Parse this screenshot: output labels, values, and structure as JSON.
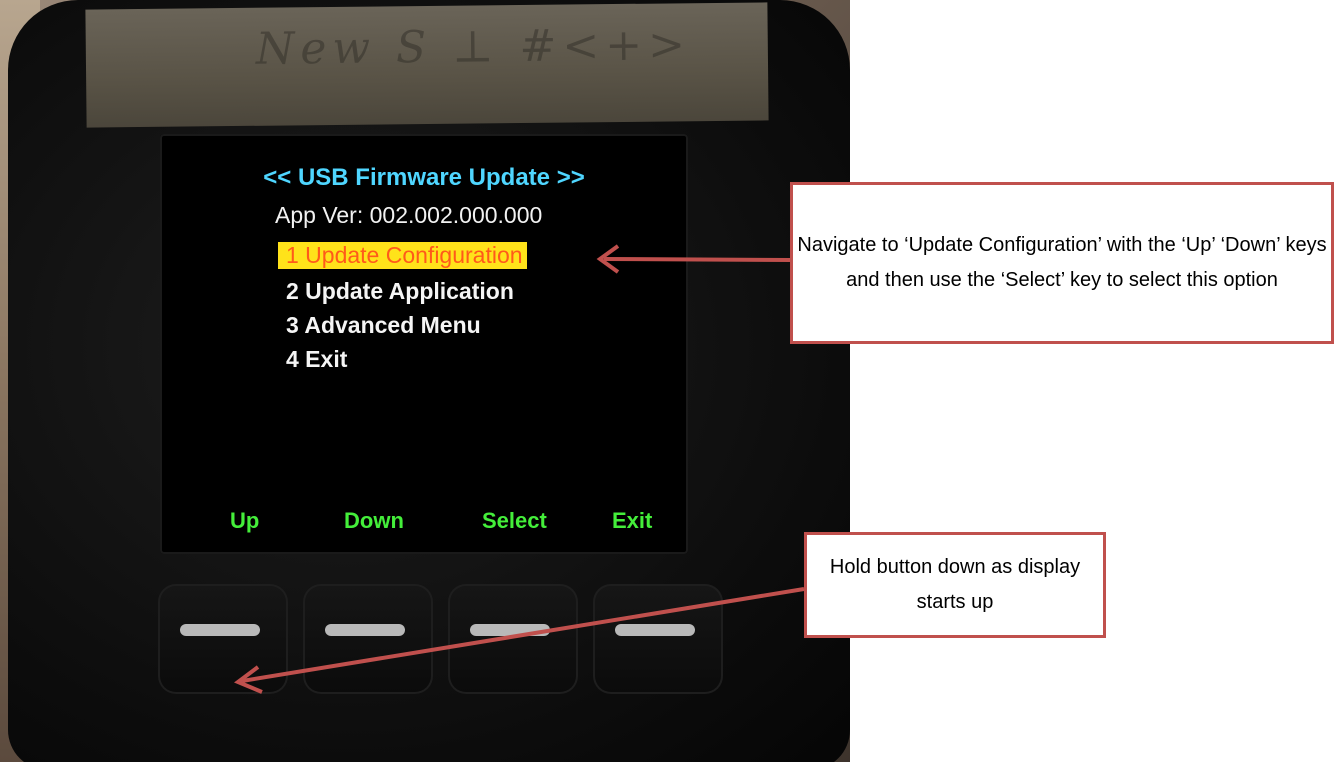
{
  "screen": {
    "title": "<< USB Firmware Update >>",
    "version": "App Ver: 002.002.000.000",
    "menu": [
      {
        "label": "1 Update Configuration",
        "selected": true
      },
      {
        "label": "2 Update Application",
        "selected": false
      },
      {
        "label": "3 Advanced Menu",
        "selected": false
      },
      {
        "label": "4 Exit",
        "selected": false
      }
    ],
    "softkeys": [
      "Up",
      "Down",
      "Select",
      "Exit"
    ]
  },
  "callouts": {
    "navigate": "Navigate to ‘Update Configuration’ with the ‘Up’ ‘Down’ keys and then use the ‘Select’ key to select this option",
    "hold": "Hold button down as display starts up"
  },
  "colors": {
    "screen_title": "#4fd6ff",
    "selected_bg": "#ffe21a",
    "selected_text": "#ff5a1a",
    "softkey_text": "#44ee3a",
    "callout_border": "#c0504d"
  }
}
